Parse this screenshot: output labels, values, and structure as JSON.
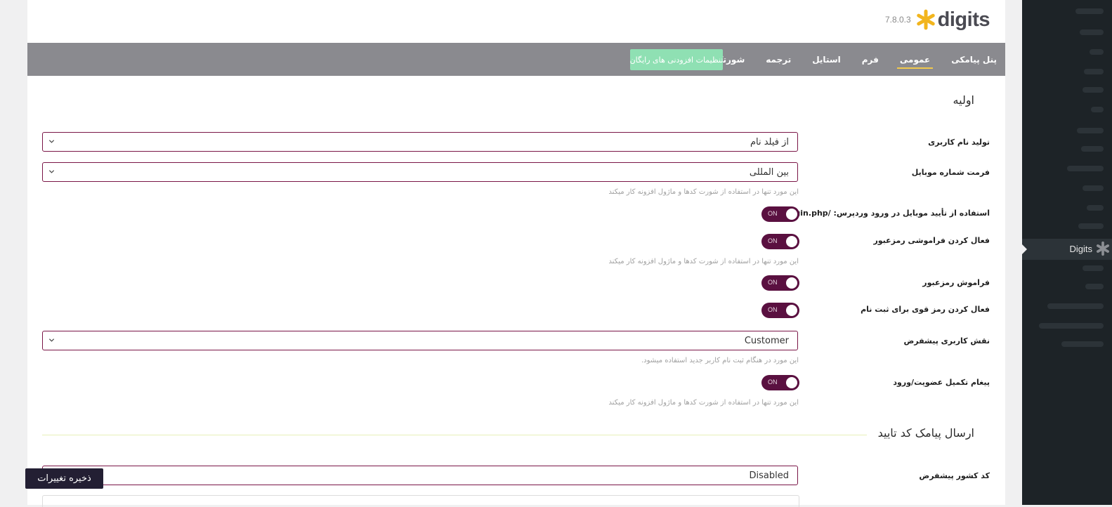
{
  "brand": {
    "name": "digits",
    "version": "7.8.0.3"
  },
  "nav": {
    "tabs": [
      "پنل پیامکی",
      "عمومی",
      "فرم",
      "استایل",
      "ترجمه",
      "شورتکد"
    ],
    "active_index": 1,
    "addons_button": "تنظیمات افزودنی های رایگان"
  },
  "sections": {
    "basic": "اولیه",
    "otp": "ارسال پیامک کد تایید"
  },
  "fields": {
    "username_generation": {
      "label": "تولید نام کاربری",
      "value": "از فیلد نام"
    },
    "mobile_format": {
      "label": "فرمت شماره موبایل",
      "value": "بین المللی",
      "hint": "این مورد تنها در استفاده از شورت کدها و ماژول افزونه کار میکند"
    },
    "wp_login_otp": {
      "label": "استفاده از تأیید موبایل در ورود وردپرس: /wp-login.php",
      "toggle": "ON"
    },
    "enable_forgot_password": {
      "label": "فعال کردن فراموشی رمزعبور",
      "toggle": "ON",
      "hint": "این مورد تنها در استفاده از شورت کدها و ماژول افزونه کار میکند"
    },
    "forgot_password": {
      "label": "فراموش رمزعبور",
      "toggle": "ON"
    },
    "strong_password": {
      "label": "فعال کردن رمز قوی برای ثبت نام",
      "toggle": "ON"
    },
    "default_role": {
      "label": "نقش کاربری پیشفرض",
      "value": "Customer",
      "hint": "این مورد در هنگام ثبت نام کاربر جدید استفاده میشود."
    },
    "completion_message": {
      "label": "پیغام تکمیل عضویت/ورود",
      "toggle": "ON",
      "hint": "این مورد تنها در استفاده از شورت کدها و ماژول افزونه کار میکند"
    },
    "default_country_code": {
      "label": "کد کشور پیشفرض",
      "value": "Disabled"
    }
  },
  "save_button": "ذخیره تغییرات",
  "sidebar": {
    "active_item": "Digits"
  },
  "colors": {
    "accent": "#5a1040",
    "field_border": "#7a1547",
    "nav_bg": "#8a8a8f",
    "addons_bg": "#8fe0b3",
    "save_bg": "#231f33",
    "sidebar_bg": "#1d2327"
  }
}
